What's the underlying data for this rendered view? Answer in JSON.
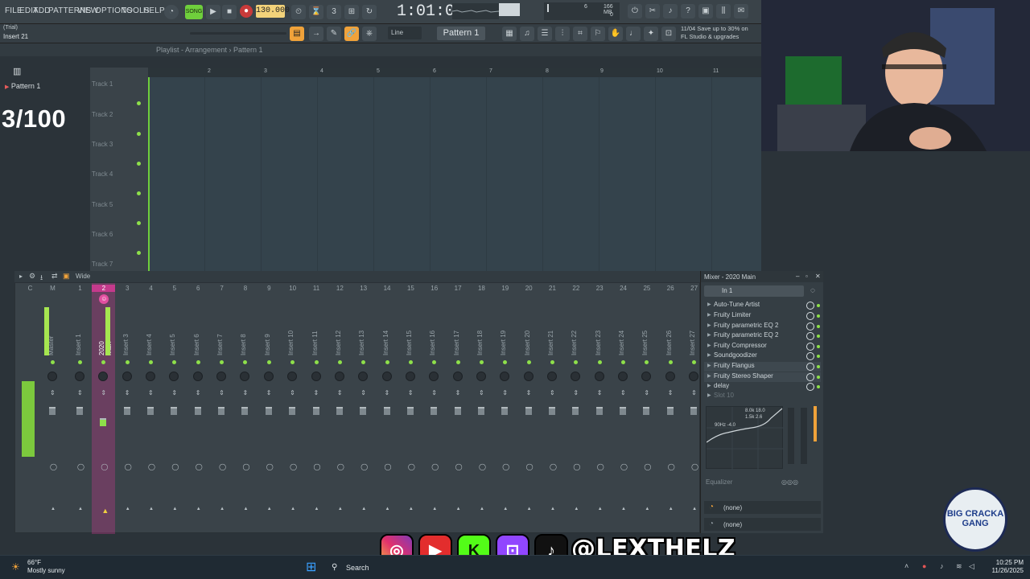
{
  "menu": {
    "items": [
      "FILE",
      "EDIT",
      "ADD",
      "PATTERNS",
      "VIEW",
      "OPTIONS",
      "TOOLS",
      "HELP"
    ],
    "song_mode": "SONG",
    "bpm": "130.000",
    "time": "1:01:00",
    "cpu_mem": "166 MB",
    "cpu_poly": "6",
    "cpu_zero": "0"
  },
  "hint": {
    "line1": "(Trial)",
    "line2": "Insert 21"
  },
  "toolbar": {
    "snap": "Line",
    "pattern": "Pattern 1"
  },
  "news": {
    "line1": "11/04  Save up to 30% on",
    "line2": "FL Studio & upgrades"
  },
  "playlist": {
    "title": "Playlist - Arrangement  ›  Pattern 1",
    "pattern_item": "Pattern 1",
    "counter": "3/100",
    "tracks": [
      "Track 1",
      "Track 2",
      "Track 3",
      "Track 4",
      "Track 5",
      "Track 6",
      "Track 7"
    ],
    "ruler": [
      "2",
      "3",
      "4",
      "5",
      "6",
      "7",
      "8",
      "9",
      "10",
      "11"
    ]
  },
  "mixer": {
    "view": "Wide",
    "strips": [
      {
        "num": "C",
        "name": ""
      },
      {
        "num": "M",
        "name": "Master"
      },
      {
        "num": "1",
        "name": "Insert 1"
      },
      {
        "num": "2",
        "name": "2020 Main"
      },
      {
        "num": "3",
        "name": "Insert 3"
      },
      {
        "num": "4",
        "name": "Insert 4"
      },
      {
        "num": "5",
        "name": "Insert 5"
      },
      {
        "num": "6",
        "name": "Insert 6"
      },
      {
        "num": "7",
        "name": "Insert 7"
      },
      {
        "num": "8",
        "name": "Insert 8"
      },
      {
        "num": "9",
        "name": "Insert 9"
      },
      {
        "num": "10",
        "name": "Insert 10"
      },
      {
        "num": "11",
        "name": "Insert 11"
      },
      {
        "num": "12",
        "name": "Insert 12"
      },
      {
        "num": "13",
        "name": "Insert 13"
      },
      {
        "num": "14",
        "name": "Insert 14"
      },
      {
        "num": "15",
        "name": "Insert 15"
      },
      {
        "num": "16",
        "name": "Insert 16"
      },
      {
        "num": "17",
        "name": "Insert 17"
      },
      {
        "num": "18",
        "name": "Insert 18"
      },
      {
        "num": "19",
        "name": "Insert 19"
      },
      {
        "num": "20",
        "name": "Insert 20"
      },
      {
        "num": "21",
        "name": "Insert 21"
      },
      {
        "num": "22",
        "name": "Insert 22"
      },
      {
        "num": "23",
        "name": "Insert 23"
      },
      {
        "num": "24",
        "name": "Insert 24"
      },
      {
        "num": "25",
        "name": "Insert 25"
      },
      {
        "num": "26",
        "name": "Insert 26"
      },
      {
        "num": "27",
        "name": "Insert 27"
      }
    ],
    "selected_strip": "2"
  },
  "mixer_panel": {
    "title": "Mixer - 2020 Main",
    "input": "In 1",
    "effects": [
      "Auto-Tune Artist",
      "Fruity Limiter",
      "Fruity parametric EQ 2",
      "Fruity parametric EQ 2",
      "Fruity Compressor",
      "Soundgoodizer",
      "Fruity Flangus",
      "Fruity Stereo Shaper",
      "delay",
      "Slot 10"
    ],
    "eq_label": "Equalizer",
    "eq_readout": "8.0k 18.0",
    "eq_readout2": "1.5k 2.6",
    "eq_readout3": "90Hz -4.0",
    "out1": "(none)",
    "out2": "(none)"
  },
  "overlay": {
    "handle": "@LEXTHELZ",
    "logo": "BIG CRACKA GANG"
  },
  "taskbar": {
    "weather_temp": "66°F",
    "weather_desc": "Mostly sunny",
    "search": "Search",
    "time": "10:25 PM",
    "date": "11/26/2025"
  },
  "colors": {
    "accent_orange": "#f0a23a",
    "led_green": "#8ee04a",
    "selected_strip": "#c53a8c"
  }
}
